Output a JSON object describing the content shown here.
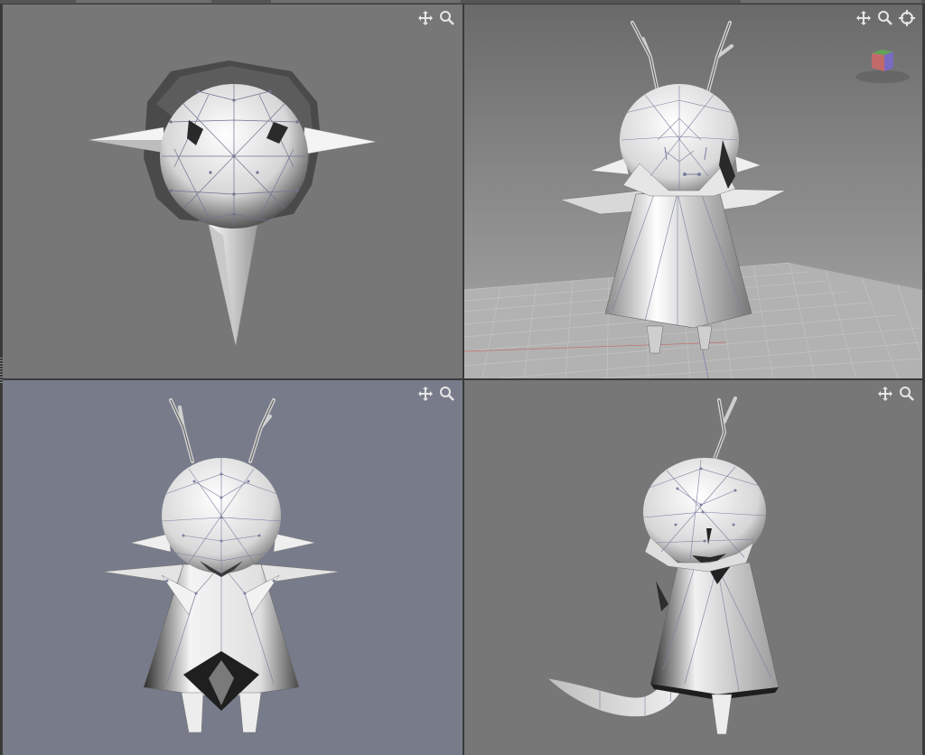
{
  "window": {
    "title": ""
  },
  "viewports": [
    {
      "id": "top",
      "tools": [
        "move-icon",
        "zoom-icon"
      ]
    },
    {
      "id": "perspective",
      "tools": [
        "move-icon",
        "zoom-icon",
        "rotate-icon"
      ],
      "nav_cube": true,
      "grid": true
    },
    {
      "id": "front",
      "tools": [
        "move-icon",
        "zoom-icon"
      ]
    },
    {
      "id": "side",
      "tools": [
        "move-icon",
        "zoom-icon"
      ]
    }
  ],
  "colors": {
    "viewport_bg": "#777777",
    "front_bg": "#787c8a",
    "mesh_light": "#f2f2f2",
    "mesh_dark": "#2b2b2b",
    "wire": "#7b7fa0",
    "grid_line": "#c6c6c6"
  }
}
